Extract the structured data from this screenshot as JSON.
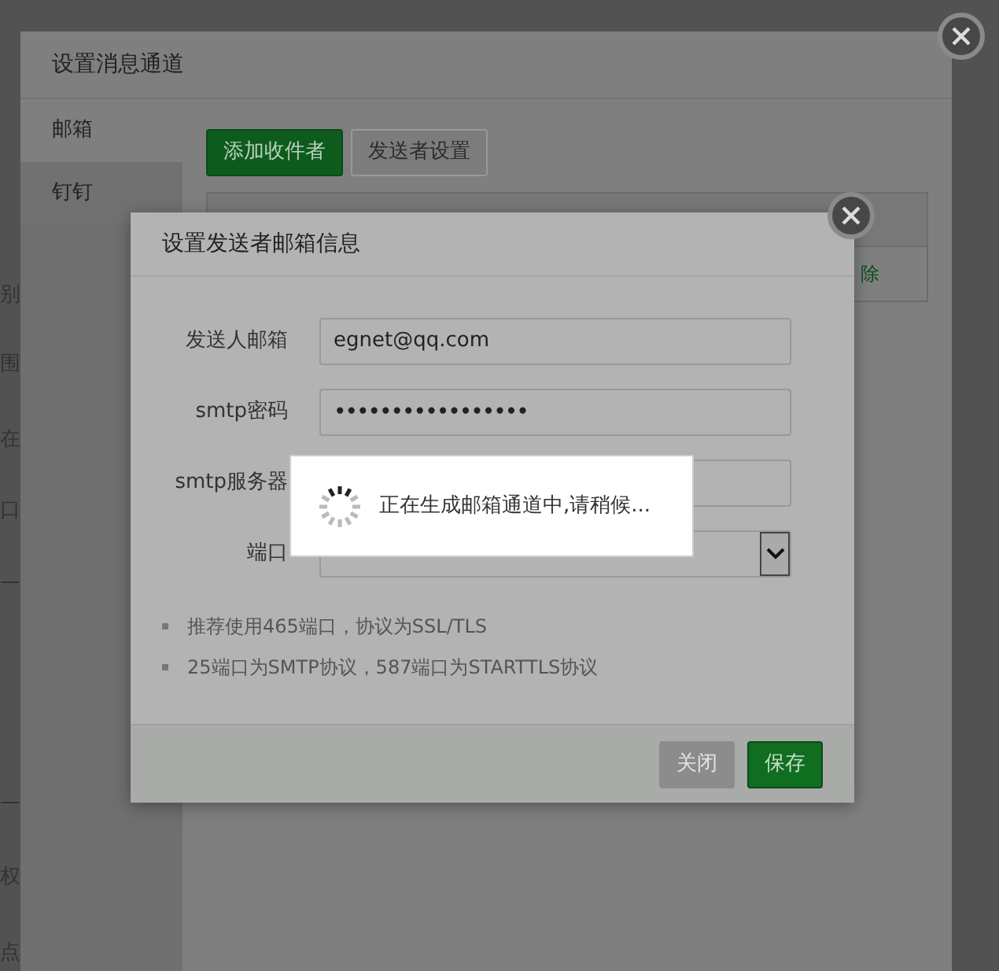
{
  "background_fragments": [
    "别",
    "围",
    "在",
    "口",
    "一",
    "一",
    "权",
    "点"
  ],
  "outer_dialog": {
    "title": "设置消息通道",
    "tabs": [
      {
        "label": "邮箱",
        "selected": true
      },
      {
        "label": "钉钉",
        "selected": false
      }
    ],
    "buttons": [
      {
        "label": "添加收件者",
        "kind": "primary"
      },
      {
        "label": "发送者设置",
        "kind": "default"
      }
    ],
    "table_row_action": "除"
  },
  "inner_dialog": {
    "title": "设置发送者邮箱信息",
    "fields": [
      {
        "label": "发送人邮箱",
        "kind": "text",
        "value": "egnet@qq.com"
      },
      {
        "label": "smtp密码",
        "kind": "password",
        "value": "•••••••••••••••••"
      },
      {
        "label": "smtp服务器",
        "kind": "text"
      },
      {
        "label": "端口",
        "kind": "select"
      }
    ],
    "notes": [
      "推荐使用465端口，协议为SSL/TLS",
      "25端口为SMTP协议，587端口为STARTTLS协议"
    ],
    "buttons": [
      {
        "label": "关闭",
        "kind": "disabled"
      },
      {
        "label": "保存",
        "kind": "primary"
      }
    ]
  },
  "toast": {
    "message": "正在生成邮箱通道中,请稍候..."
  }
}
